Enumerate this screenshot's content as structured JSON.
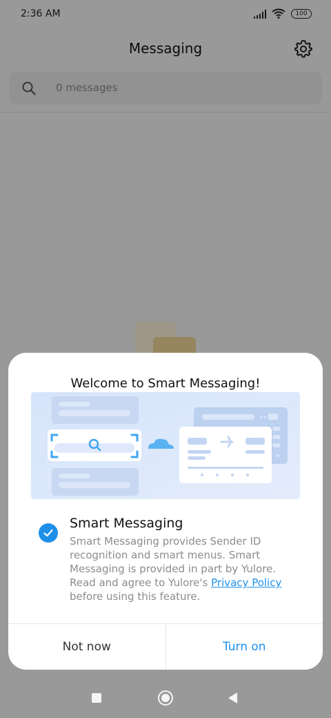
{
  "status_bar": {
    "time": "2:36 AM",
    "battery": "100"
  },
  "header": {
    "title": "Messaging",
    "settings_icon": "gear-icon"
  },
  "search": {
    "placeholder": "0 messages",
    "icon": "search-icon"
  },
  "dialog": {
    "title": "Welcome to Smart Messaging!",
    "option": {
      "title": "Smart Messaging",
      "checked": true,
      "desc_part1": "Smart Messaging provides Sender ID recognition and smart menus. Smart Messaging is provided in part by Yulore. Read and agree to Yulore's ",
      "link_text": "Privacy Policy",
      "desc_part2": " before using this feature."
    },
    "buttons": {
      "cancel": "Not now",
      "confirm": "Turn on"
    }
  },
  "colors": {
    "accent": "#1e90ea"
  },
  "nav": {
    "icons": [
      "recents-icon",
      "home-icon",
      "back-icon"
    ]
  }
}
